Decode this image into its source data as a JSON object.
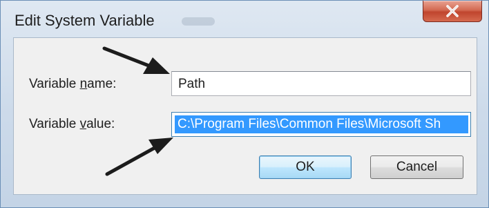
{
  "window": {
    "title": "Edit System Variable",
    "close_glyph": "X"
  },
  "form": {
    "name_label_pre": "Variable ",
    "name_label_hot": "n",
    "name_label_post": "ame:",
    "name_value": "Path",
    "value_label_pre": "Variable ",
    "value_label_hot": "v",
    "value_label_post": "alue:",
    "value_value": "C:\\Program Files\\Common Files\\Microsoft Sh"
  },
  "buttons": {
    "ok_label": "OK",
    "cancel_label": "Cancel"
  },
  "colors": {
    "selection": "#3399ff",
    "close_button": "#c0452e",
    "arrow": "#1c1c1c"
  }
}
